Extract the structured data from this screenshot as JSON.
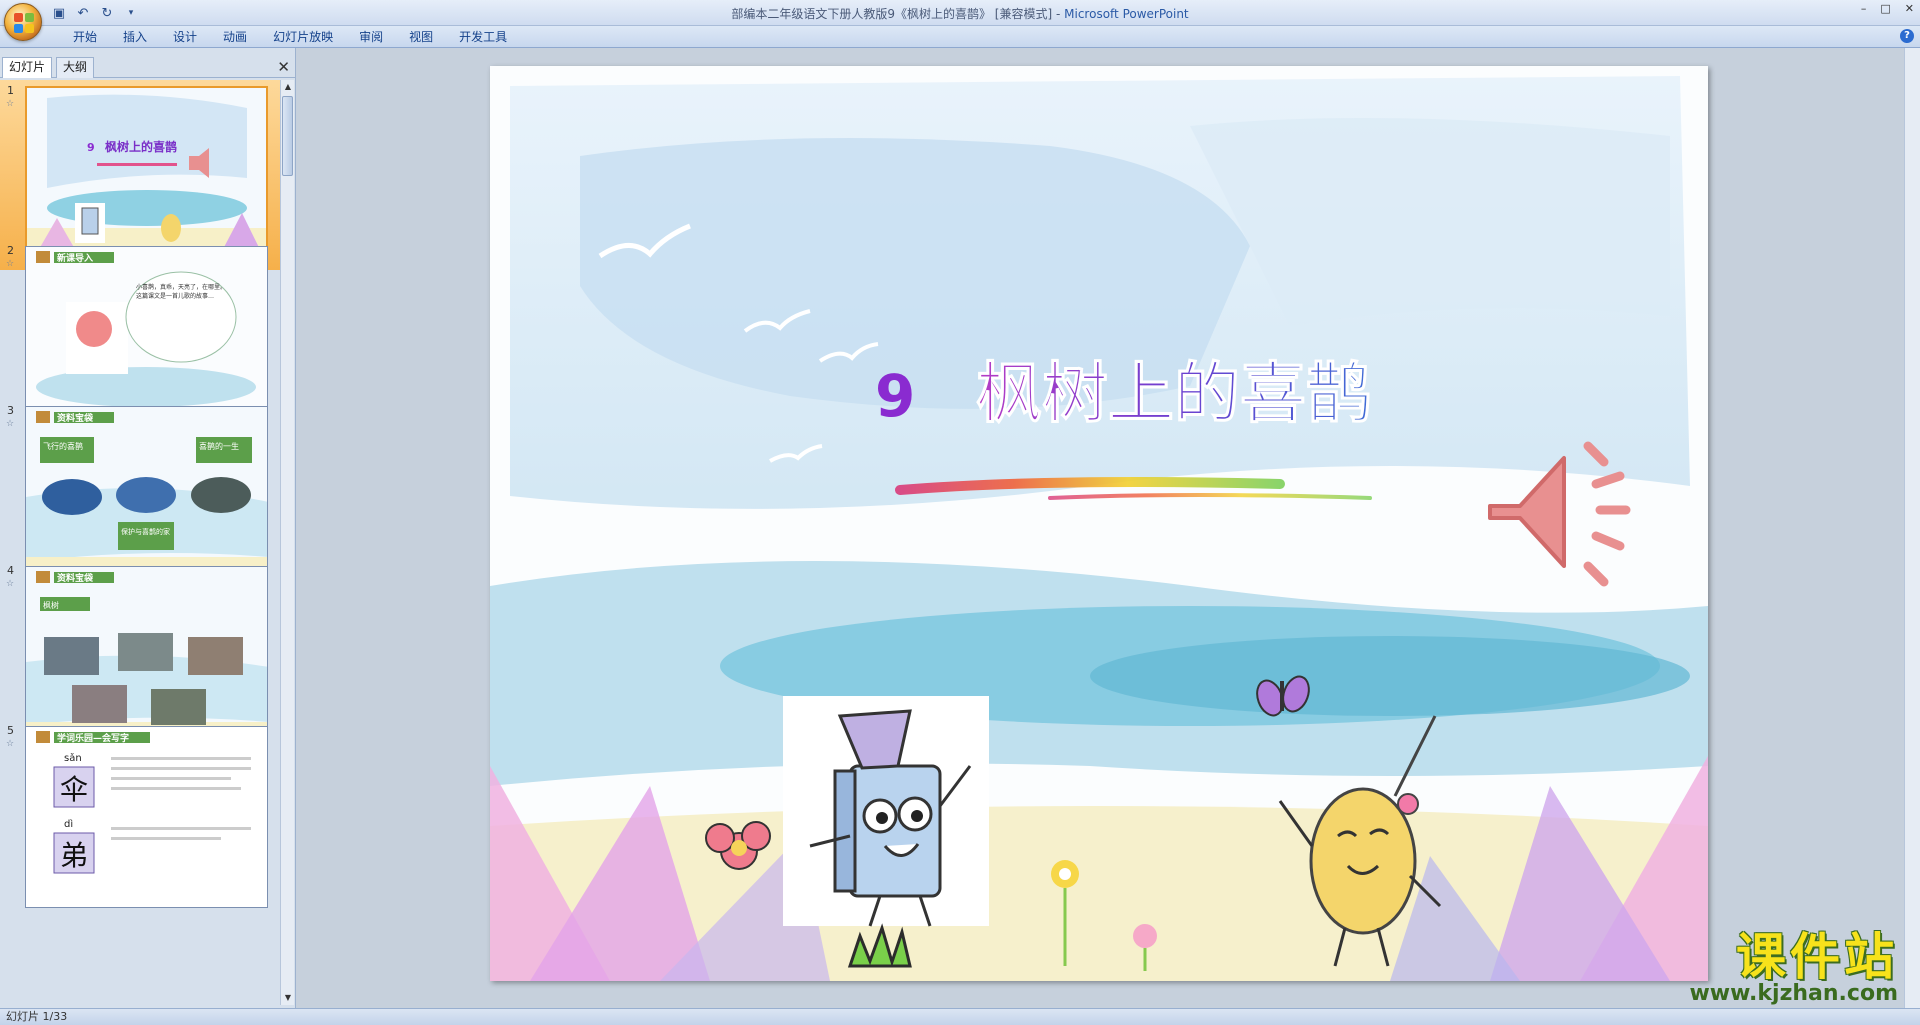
{
  "window": {
    "title_doc": "部编本二年级语文下册人教版9《枫树上的喜鹊》 [兼容模式] - ",
    "title_app": "Microsoft PowerPoint",
    "minimize": "–",
    "maximize": "□",
    "close": "✕"
  },
  "ribbon": {
    "tabs": [
      "开始",
      "插入",
      "设计",
      "动画",
      "幻灯片放映",
      "审阅",
      "视图",
      "开发工具"
    ],
    "help": "?"
  },
  "left_panel": {
    "tab_slides": "幻灯片",
    "tab_outline": "大纲",
    "close": "✕",
    "thumbnails": [
      {
        "num": "1",
        "title": "枫树上的喜鹊",
        "title_num": "9"
      },
      {
        "num": "2",
        "header": "新课导入",
        "bubble": "小喜鹊，真乖，天亮了，在哪里。这篇课文是一首儿歌的故事…"
      },
      {
        "num": "3",
        "header": "资料宝袋",
        "label_a": "飞行的喜鹊",
        "label_b": "喜鹊的一生",
        "label_c": "保护与喜鹊的家"
      },
      {
        "num": "4",
        "header": "资料宝袋",
        "label_a": "枫树"
      },
      {
        "num": "5",
        "header": "学词乐园—会写字",
        "pinyin_1": "sǎn",
        "char_1": "伞",
        "pinyin_2": "dì",
        "char_2": "弟"
      }
    ]
  },
  "slide": {
    "number": "9",
    "title": "枫树上的喜鹊"
  },
  "status": {
    "text": "幻灯片 1/33"
  },
  "watermark": {
    "main": "课件站",
    "url": "www.kjzhan.com"
  },
  "colors": {
    "accent": "#15428b",
    "selected_thumb": "#f6b04a",
    "speaker": "#e89090"
  }
}
